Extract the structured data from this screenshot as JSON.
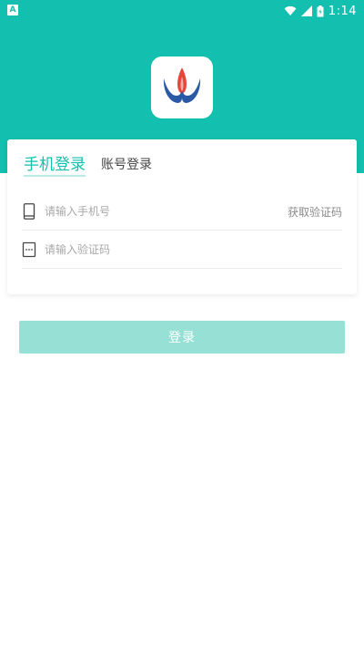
{
  "status_bar": {
    "left_icon": "A",
    "time": "1:14",
    "icons": [
      "wifi-icon",
      "signal-icon",
      "battery-icon"
    ]
  },
  "logo": {
    "icon": "app-logo-icon"
  },
  "tabs": {
    "active_label": "手机登录",
    "inactive_label": "账号登录"
  },
  "form": {
    "phone_placeholder": "请输入手机号",
    "phone_value": "",
    "get_code_label": "获取验证码",
    "code_placeholder": "请输入验证码",
    "code_value": ""
  },
  "login_label": "登录",
  "colors": {
    "accent": "#13bfae",
    "button_disabled": "#96e0d6"
  }
}
